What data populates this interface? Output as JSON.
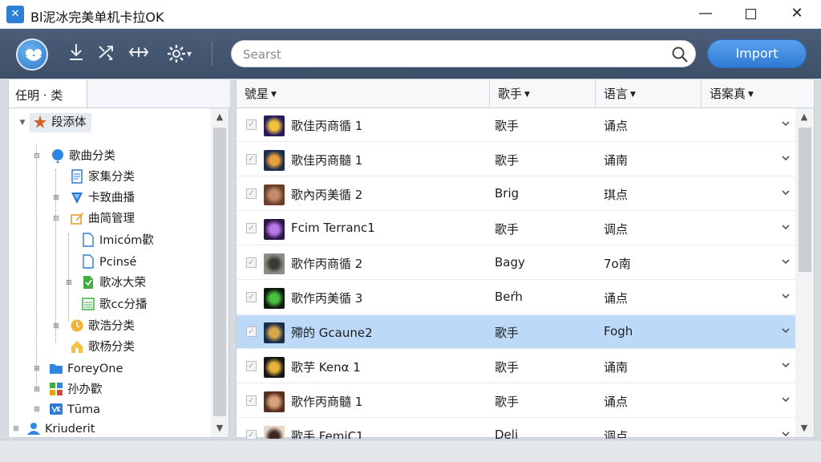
{
  "window": {
    "title": "Bl泥冰完美单机卡拉OK",
    "minimize": "—",
    "close": "✕"
  },
  "toolbar": {
    "search_placeholder": "Searst",
    "import_label": "Import",
    "settings_caret": "▾"
  },
  "left_panel": {
    "header": "任明 · 类",
    "tree": [
      {
        "label": "段添体",
        "icon": "star-icon",
        "level": 0
      },
      {
        "label": "歌曲分类",
        "icon": "balloon-icon",
        "level": 1
      },
      {
        "label": "家集分类",
        "icon": "document-icon",
        "level": 2
      },
      {
        "label": "卡致曲播",
        "icon": "shield-icon",
        "level": 2
      },
      {
        "label": "曲简管理",
        "icon": "edit-icon",
        "level": 2
      },
      {
        "label": "Imicóm歡",
        "icon": "file-icon",
        "level": 3
      },
      {
        "label": "Pcinsé",
        "icon": "file-icon",
        "level": 3
      },
      {
        "label": "歌冰大荣",
        "icon": "green-file-icon",
        "level": 3
      },
      {
        "label": "歌cc分播",
        "icon": "sheet-icon",
        "level": 3
      },
      {
        "label": "歌浩分类",
        "icon": "clock-icon",
        "level": 2
      },
      {
        "label": "歌杨分类",
        "icon": "house-icon",
        "level": 2
      },
      {
        "label": "ForeyOne",
        "icon": "folder-icon",
        "level": 1
      },
      {
        "label": "孙办歡",
        "icon": "apps-icon",
        "level": 1
      },
      {
        "label": "Tūma",
        "icon": "vk-icon",
        "level": 1
      },
      {
        "label": "Kriuderit",
        "icon": "person-icon",
        "level": 0
      }
    ]
  },
  "song_list": {
    "columns": [
      {
        "label": "號星"
      },
      {
        "label": "歌手"
      },
      {
        "label": "语言"
      },
      {
        "label": "语案真"
      }
    ],
    "rows": [
      {
        "title": "歌佳丙商循 1",
        "artist": "歌手",
        "language": "诵点",
        "thumb_colors": [
          "#2a1a5e",
          "#f2c23a"
        ],
        "selected": false
      },
      {
        "title": "歌佳丙商髓 1",
        "artist": "歌手",
        "language": "诵南",
        "thumb_colors": [
          "#1d2c4f",
          "#e8a13a"
        ],
        "selected": false
      },
      {
        "title": "歌內丙美循 2",
        "artist": "Brig",
        "language": "琪点",
        "thumb_colors": [
          "#6b3f2a",
          "#c48a6b"
        ],
        "selected": false
      },
      {
        "title": "Fcim Terranc1",
        "artist": "歌手",
        "language": "调点",
        "thumb_colors": [
          "#2c1647",
          "#b977e8"
        ],
        "selected": false
      },
      {
        "title": "歌作丙商循 2",
        "artist": "Bagу",
        "language": "7o南",
        "thumb_colors": [
          "#8d8d85",
          "#3b3b35"
        ],
        "selected": false
      },
      {
        "title": "歌作丙美循 3",
        "artist": "Beŕh",
        "language": "诵点",
        "thumb_colors": [
          "#0e1a0f",
          "#48c03d"
        ],
        "selected": false
      },
      {
        "title": "殢的 Gcaune2",
        "artist": "歌手",
        "language": "Fogh",
        "thumb_colors": [
          "#1a2e4a",
          "#d8a64a"
        ],
        "selected": true
      },
      {
        "title": "歌芋 Kenα 1",
        "artist": "歌手",
        "language": "诵南",
        "thumb_colors": [
          "#161616",
          "#e8b23a"
        ],
        "selected": false
      },
      {
        "title": "歌作丙商髓 1",
        "artist": "歌手",
        "language": "诵点",
        "thumb_colors": [
          "#5a2f1e",
          "#d9a37a"
        ],
        "selected": false
      },
      {
        "title": "歌手 FemiC1",
        "artist": "Deli",
        "language": "调点",
        "thumb_colors": [
          "#e9d6c6",
          "#3a2a22"
        ],
        "selected": false
      }
    ]
  },
  "colors": {
    "toolbar": "#44566f",
    "accent": "#2f7ad4",
    "selection": "#bcdaf7"
  }
}
